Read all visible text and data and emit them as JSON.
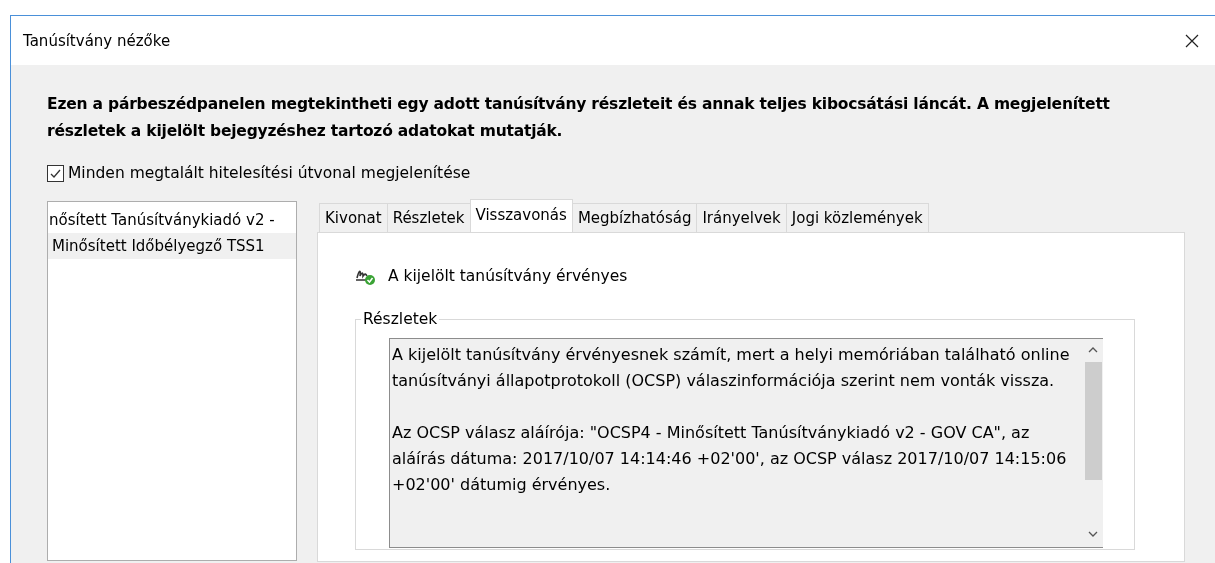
{
  "window": {
    "title": "Tanúsítvány nézőke"
  },
  "description": "Ezen a párbeszédpanelen megtekintheti egy adott tanúsítvány részleteit és annak teljes kibocsátási láncát. A megjelenített részletek a kijelölt bejegyzéshez tartozó adatokat mutatják.",
  "show_all_paths": {
    "label": "Minden megtalált hitelesítési útvonal megjelenítése",
    "checked": true
  },
  "chain": [
    {
      "label": "nősített Tanúsítványkiadó v2 -",
      "selected": false
    },
    {
      "label": "Minősített Időbélyegző TSS1",
      "selected": true
    }
  ],
  "tabs": [
    {
      "label": "Kivonat",
      "selected": false
    },
    {
      "label": "Részletek",
      "selected": false
    },
    {
      "label": "Visszavonás",
      "selected": true
    },
    {
      "label": "Megbízhatóság",
      "selected": false
    },
    {
      "label": "Irányelvek",
      "selected": false
    },
    {
      "label": "Jogi közlemények",
      "selected": false
    }
  ],
  "status": "A kijelölt tanúsítvány érvényes",
  "details": {
    "title": "Részletek",
    "paragraphs": [
      "A kijelölt tanúsítvány érvényesnek számít, mert a helyi memóriában található online tanúsítványi állapotprotokoll (OCSP) válaszinformációja szerint nem vonták vissza.",
      "Az OCSP válasz aláírója: \"OCSP4 - Minősített Tanúsítványkiadó v2 - GOV CA\", az aláírás dátuma: 2017/10/07 14:14:46 +02'00', az OCSP válasz 2017/10/07 14:15:06 +02'00' dátumig érvényes."
    ]
  }
}
